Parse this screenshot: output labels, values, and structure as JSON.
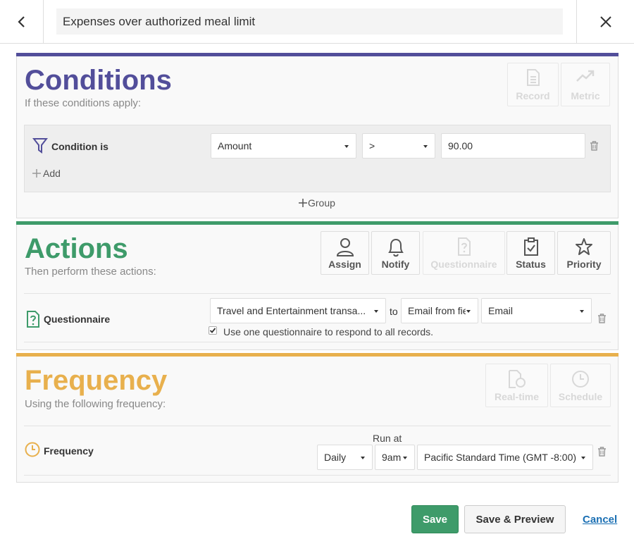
{
  "header": {
    "title": "Expenses over authorized meal limit"
  },
  "conditions": {
    "title": "Conditions",
    "subtitle": "If these conditions apply:",
    "accent": "#524e9a",
    "tools": [
      {
        "label": "Record",
        "icon": "record-icon",
        "disabled": true
      },
      {
        "label": "Metric",
        "icon": "metric-icon",
        "disabled": true
      }
    ],
    "row_label": "Condition is",
    "field": "Amount",
    "operator": ">",
    "value": "90.00",
    "add_label": "Add",
    "group_label": "Group"
  },
  "actions": {
    "title": "Actions",
    "subtitle": "Then perform these actions:",
    "accent": "#3e9b6a",
    "tools": [
      {
        "label": "Assign",
        "icon": "user-icon",
        "disabled": false
      },
      {
        "label": "Notify",
        "icon": "bell-icon",
        "disabled": false
      },
      {
        "label": "Questionnaire",
        "icon": "questionnaire-icon",
        "disabled": true
      },
      {
        "label": "Status",
        "icon": "clipboard-check-icon",
        "disabled": false
      },
      {
        "label": "Priority",
        "icon": "star-icon",
        "disabled": false
      }
    ],
    "row_label": "Questionnaire",
    "questionnaire": "Travel and Entertainment transa...",
    "to_label": "to",
    "recipient_source": "Email from fie",
    "recipient_field": "Email",
    "checkbox_label": "Use one questionnaire to respond to all records.",
    "checkbox_checked": true
  },
  "frequency": {
    "title": "Frequency",
    "subtitle": "Using the following frequency:",
    "accent": "#e8b04d",
    "tools": [
      {
        "label": "Real-time",
        "icon": "realtime-icon",
        "disabled": true
      },
      {
        "label": "Schedule",
        "icon": "clock-icon",
        "disabled": true
      }
    ],
    "row_label": "Frequency",
    "run_at_label": "Run at",
    "period": "Daily",
    "time": "9am",
    "timezone": "Pacific Standard Time (GMT -8:00)"
  },
  "footer": {
    "save": "Save",
    "save_preview": "Save & Preview",
    "cancel": "Cancel"
  }
}
